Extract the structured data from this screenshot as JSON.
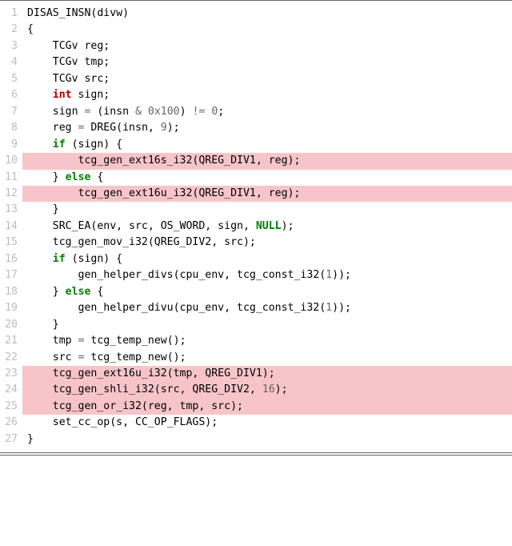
{
  "code": {
    "lines": [
      {
        "n": 1,
        "hl": false,
        "segs": [
          [
            "DISAS_INSN(divw)",
            ""
          ]
        ]
      },
      {
        "n": 2,
        "hl": false,
        "segs": [
          [
            "{",
            ""
          ]
        ]
      },
      {
        "n": 3,
        "hl": false,
        "segs": [
          [
            "    TCGv reg;",
            ""
          ]
        ]
      },
      {
        "n": 4,
        "hl": false,
        "segs": [
          [
            "    TCGv tmp;",
            ""
          ]
        ]
      },
      {
        "n": 5,
        "hl": false,
        "segs": [
          [
            "    TCGv src;",
            ""
          ]
        ]
      },
      {
        "n": 6,
        "hl": false,
        "segs": [
          [
            "    ",
            ""
          ],
          [
            "int",
            "intkw"
          ],
          [
            " sign;",
            ""
          ]
        ]
      },
      {
        "n": 7,
        "hl": false,
        "segs": [
          [
            "    sign ",
            ""
          ],
          [
            "=",
            "op"
          ],
          [
            " (insn ",
            ""
          ],
          [
            "&",
            "op"
          ],
          [
            " ",
            ""
          ],
          [
            "0x100",
            "num"
          ],
          [
            ") ",
            ""
          ],
          [
            "!=",
            "op"
          ],
          [
            " ",
            ""
          ],
          [
            "0",
            "num"
          ],
          [
            ";",
            ""
          ]
        ]
      },
      {
        "n": 8,
        "hl": false,
        "segs": [
          [
            "    reg ",
            ""
          ],
          [
            "=",
            "op"
          ],
          [
            " DREG(insn, ",
            ""
          ],
          [
            "9",
            "num"
          ],
          [
            ");",
            ""
          ]
        ]
      },
      {
        "n": 9,
        "hl": false,
        "segs": [
          [
            "    ",
            ""
          ],
          [
            "if",
            "kw"
          ],
          [
            " (sign) {",
            ""
          ]
        ]
      },
      {
        "n": 10,
        "hl": true,
        "segs": [
          [
            "        tcg_gen_ext16s_i32(QREG_DIV1, reg);",
            ""
          ]
        ]
      },
      {
        "n": 11,
        "hl": false,
        "segs": [
          [
            "    } ",
            ""
          ],
          [
            "else",
            "kw"
          ],
          [
            " {",
            ""
          ]
        ]
      },
      {
        "n": 12,
        "hl": true,
        "segs": [
          [
            "        tcg_gen_ext16u_i32(QREG_DIV1, reg);",
            ""
          ]
        ]
      },
      {
        "n": 13,
        "hl": false,
        "segs": [
          [
            "    }",
            ""
          ]
        ]
      },
      {
        "n": 14,
        "hl": false,
        "segs": [
          [
            "    SRC_EA(env, src, OS_WORD, sign, ",
            ""
          ],
          [
            "NULL",
            "nullc"
          ],
          [
            ");",
            ""
          ]
        ]
      },
      {
        "n": 15,
        "hl": false,
        "segs": [
          [
            "    tcg_gen_mov_i32(QREG_DIV2, src);",
            ""
          ]
        ]
      },
      {
        "n": 16,
        "hl": false,
        "segs": [
          [
            "    ",
            ""
          ],
          [
            "if",
            "kw"
          ],
          [
            " (sign) {",
            ""
          ]
        ]
      },
      {
        "n": 17,
        "hl": false,
        "segs": [
          [
            "        gen_helper_divs(cpu_env, tcg_const_i32(",
            ""
          ],
          [
            "1",
            "num"
          ],
          [
            "));",
            ""
          ]
        ]
      },
      {
        "n": 18,
        "hl": false,
        "segs": [
          [
            "    } ",
            ""
          ],
          [
            "else",
            "kw"
          ],
          [
            " {",
            ""
          ]
        ]
      },
      {
        "n": 19,
        "hl": false,
        "segs": [
          [
            "        gen_helper_divu(cpu_env, tcg_const_i32(",
            ""
          ],
          [
            "1",
            "num"
          ],
          [
            "));",
            ""
          ]
        ]
      },
      {
        "n": 20,
        "hl": false,
        "segs": [
          [
            "    }",
            ""
          ]
        ]
      },
      {
        "n": 21,
        "hl": false,
        "segs": [
          [
            "    tmp ",
            ""
          ],
          [
            "=",
            "op"
          ],
          [
            " tcg_temp_new();",
            ""
          ]
        ]
      },
      {
        "n": 22,
        "hl": false,
        "segs": [
          [
            "    src ",
            ""
          ],
          [
            "=",
            "op"
          ],
          [
            " tcg_temp_new();",
            ""
          ]
        ]
      },
      {
        "n": 23,
        "hl": true,
        "segs": [
          [
            "    tcg_gen_ext16u_i32(tmp, QREG_DIV1);",
            ""
          ]
        ]
      },
      {
        "n": 24,
        "hl": true,
        "segs": [
          [
            "    tcg_gen_shli_i32(src, QREG_DIV2, ",
            ""
          ],
          [
            "16",
            "num"
          ],
          [
            ");",
            ""
          ]
        ]
      },
      {
        "n": 25,
        "hl": true,
        "segs": [
          [
            "    tcg_gen_or_i32(reg, tmp, src);",
            ""
          ]
        ]
      },
      {
        "n": 26,
        "hl": false,
        "segs": [
          [
            "    set_cc_op(s, CC_OP_FLAGS);",
            ""
          ]
        ]
      },
      {
        "n": 27,
        "hl": false,
        "segs": [
          [
            "}",
            ""
          ]
        ]
      }
    ]
  }
}
